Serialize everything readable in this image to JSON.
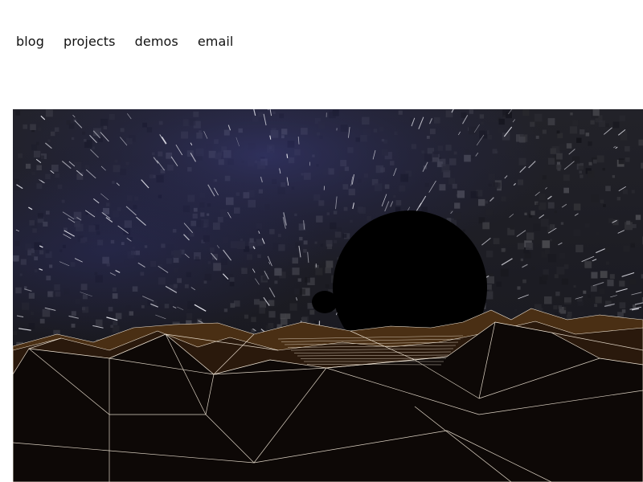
{
  "nav": {
    "items": [
      {
        "label": "blog"
      },
      {
        "label": "projects"
      },
      {
        "label": "demos"
      },
      {
        "label": "email"
      }
    ]
  },
  "hero": {
    "colors": {
      "sky_top": "#1b1b22",
      "sky_mid": "#2a2a3a",
      "nebula": "#2b2c64",
      "planet": "#000000",
      "terrain_dark": "#0c0806",
      "terrain_lit": "#5a3b18",
      "wire": "#f3e8d8"
    }
  }
}
